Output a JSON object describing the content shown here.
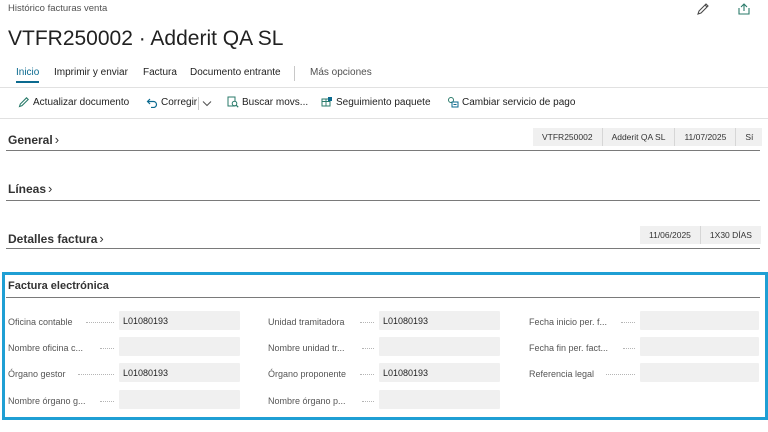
{
  "header": {
    "breadcrumb": "Histórico facturas venta",
    "title": "VTFR250002 · Adderit QA SL",
    "edit_icon": "pencil-icon",
    "share_icon": "share-icon"
  },
  "action_bar": {
    "tabs": [
      "Inicio",
      "Imprimir y enviar",
      "Factura",
      "Documento entrante"
    ],
    "more": "Más opciones"
  },
  "toolbar": {
    "items": [
      {
        "label": "Actualizar documento",
        "icon": "pencil-icon"
      },
      {
        "label": "Corregir",
        "icon": "undo-icon"
      },
      {
        "label": "Buscar movs...",
        "icon": "search-document-icon"
      },
      {
        "label": "Seguimiento paquete",
        "icon": "package-icon"
      },
      {
        "label": "Cambiar servicio de pago",
        "icon": "payment-service-icon"
      }
    ]
  },
  "sections": {
    "general": {
      "title": "General",
      "summary": [
        "VTFR250002",
        "Adderit QA SL",
        "11/07/2025",
        "Sí"
      ]
    },
    "lineas": {
      "title": "Líneas"
    },
    "detalles": {
      "title": "Detalles factura",
      "summary": [
        "11/06/2025",
        "1X30 DÍAS"
      ]
    }
  },
  "factura_electronica": {
    "title": "Factura electrónica",
    "columns": [
      [
        {
          "label": "Oficina contable",
          "value": "L01080193"
        },
        {
          "label": "Nombre oficina c...",
          "value": ""
        },
        {
          "label": "Órgano gestor",
          "value": "L01080193"
        },
        {
          "label": "Nombre órgano g...",
          "value": ""
        }
      ],
      [
        {
          "label": "Unidad tramitadora",
          "value": "L01080193"
        },
        {
          "label": "Nombre unidad tr...",
          "value": ""
        },
        {
          "label": "Órgano proponente",
          "value": "L01080193"
        },
        {
          "label": "Nombre órgano p...",
          "value": ""
        }
      ],
      [
        {
          "label": "Fecha inicio per. f...",
          "value": ""
        },
        {
          "label": "Fecha fin per. fact...",
          "value": ""
        },
        {
          "label": "Referencia legal",
          "value": ""
        }
      ]
    ]
  },
  "colors": {
    "accent": "#0b6a8f",
    "highlight_border": "#1f9fd4",
    "field_bg": "#f0f0f0"
  }
}
